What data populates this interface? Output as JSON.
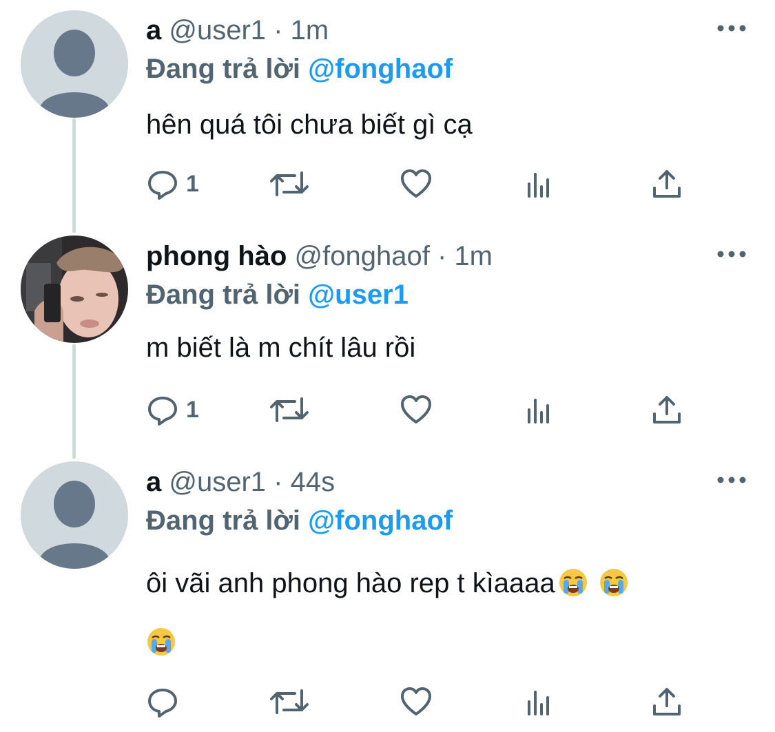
{
  "tweets": [
    {
      "name": "a",
      "handle": "@user1",
      "time": "1m",
      "replying_label": "Đang trả lời",
      "replying_to": "@fonghaof",
      "text": "hên quá tôi chưa biết gì cạ",
      "reply_count": "1",
      "avatar": "default-avatar"
    },
    {
      "name": "phong hào",
      "handle": "@fonghaof",
      "time": "1m",
      "replying_label": "Đang trả lời",
      "replying_to": "@user1",
      "text": "m biết là m chít lâu rồi",
      "reply_count": "1",
      "avatar": "photo-avatar"
    },
    {
      "name": "a",
      "handle": "@user1",
      "time": "44s",
      "replying_label": "Đang trả lời",
      "replying_to": "@fonghaof",
      "text_line1": "ôi vãi anh phong hào rep t kìaaaa",
      "reply_count": "",
      "avatar": "default-avatar",
      "emojis": [
        "loudly-crying-face",
        "loudly-crying-face",
        "loudly-crying-face"
      ]
    }
  ],
  "separator": " · ",
  "colors": {
    "text": "#0f1419",
    "secondary": "#536471",
    "accent": "#1d9bf0",
    "thread_line": "#cfd9de",
    "avatar_bg": "#cfd9de",
    "avatar_figure": "#66788a"
  },
  "icons": [
    "reply-icon",
    "retweet-icon",
    "like-icon",
    "views-icon",
    "share-icon",
    "more-icon"
  ]
}
